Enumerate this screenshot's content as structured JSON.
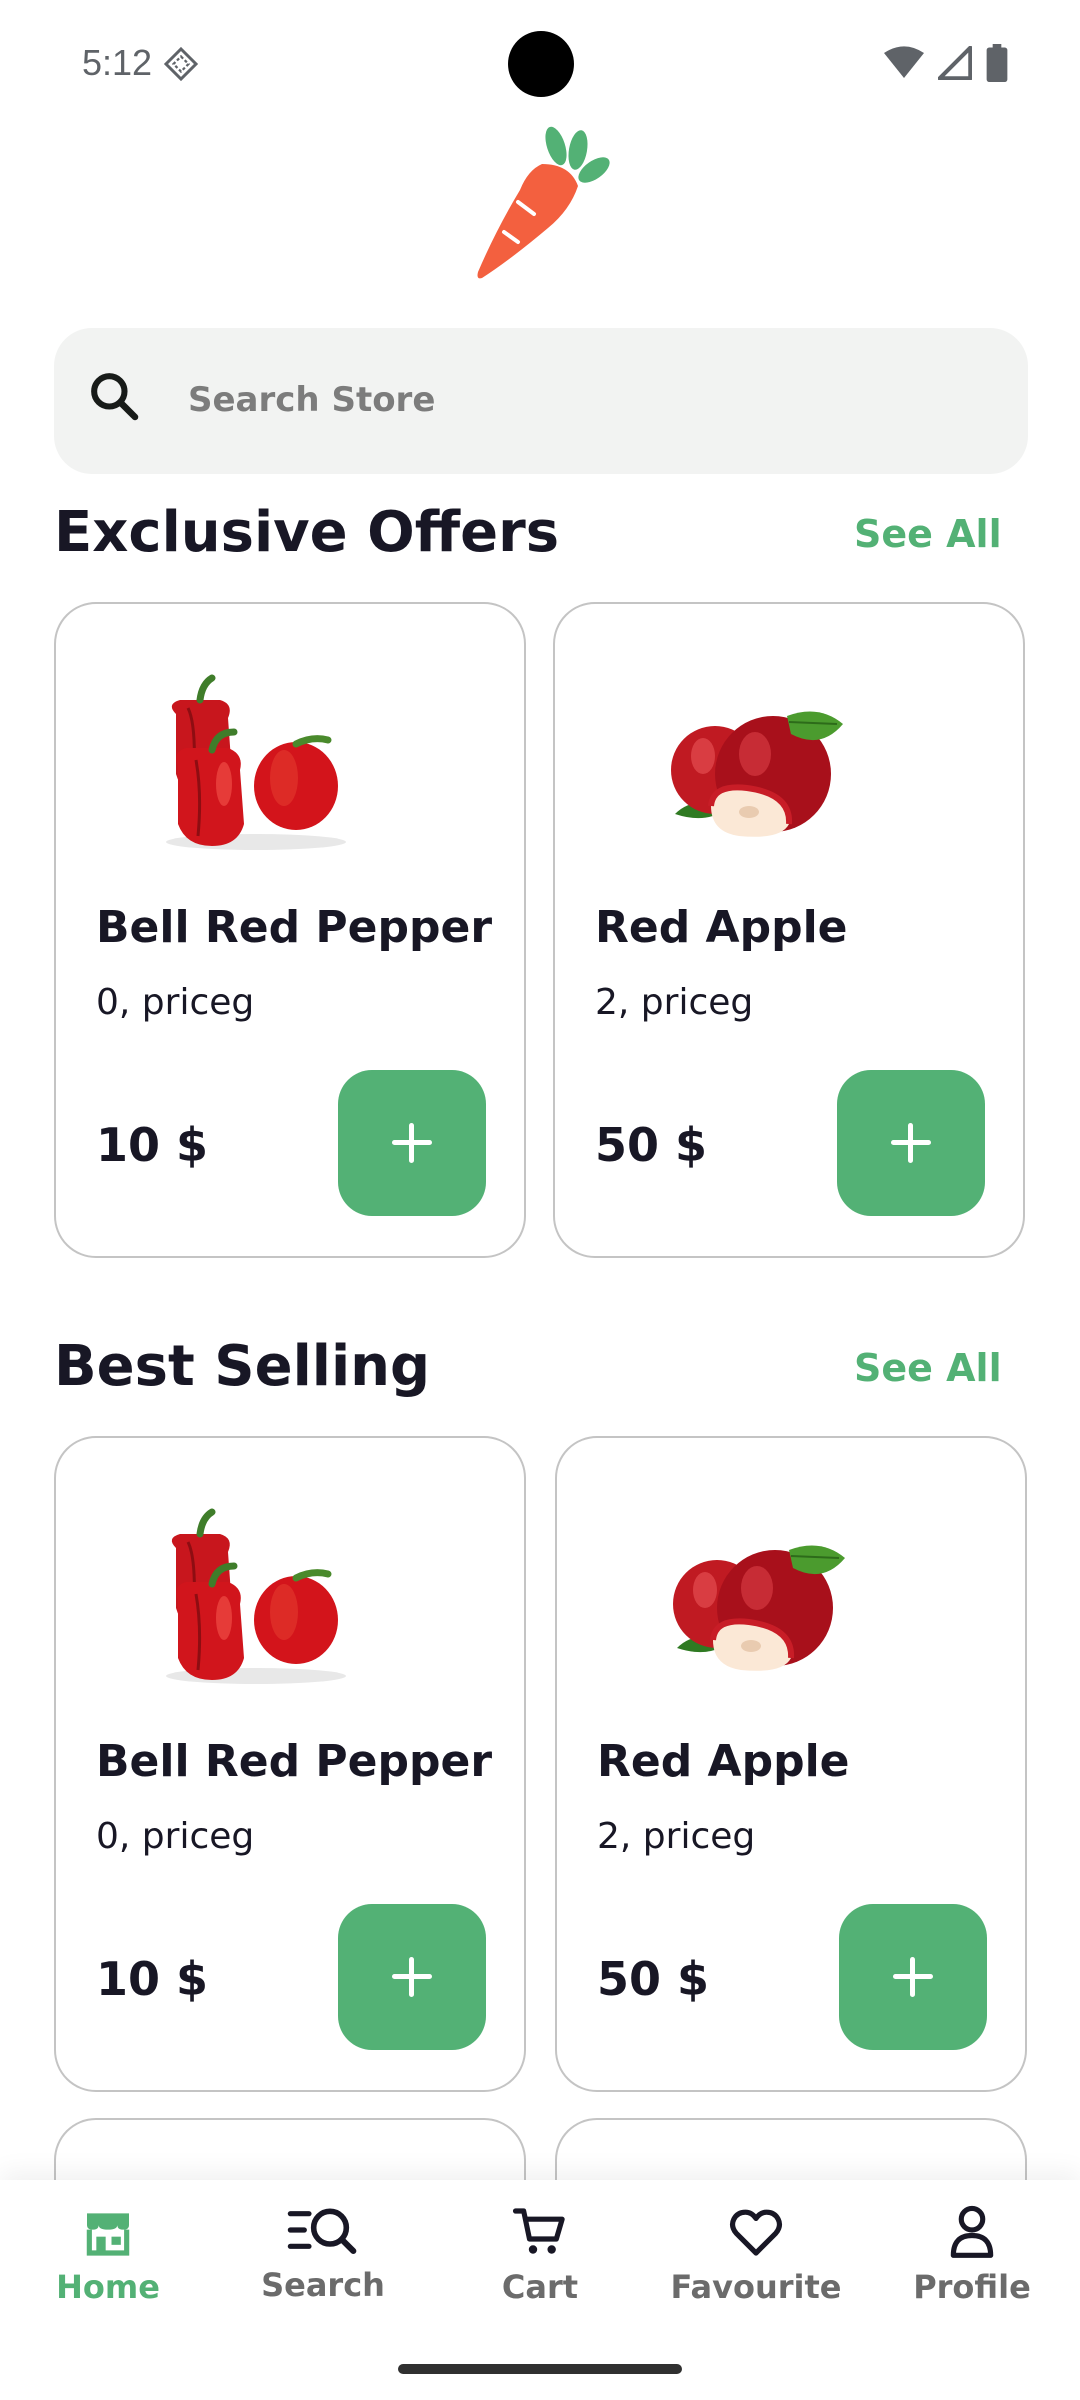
{
  "status_bar": {
    "time": "5:12"
  },
  "search": {
    "placeholder": "Search Store"
  },
  "sections": [
    {
      "title": "Exclusive Offers",
      "see_all": "See All",
      "products": [
        {
          "name": "Bell Red Pepper",
          "subtitle": "0, priceg",
          "price": "10 $",
          "image": "bell-pepper"
        },
        {
          "name": "Red Apple",
          "subtitle": "2, priceg",
          "price": "50 $",
          "image": "red-apple"
        }
      ]
    },
    {
      "title": "Best Selling",
      "see_all": "See All",
      "products": [
        {
          "name": "Bell Red Pepper",
          "subtitle": "0, priceg",
          "price": "10 $",
          "image": "bell-pepper"
        },
        {
          "name": "Red Apple",
          "subtitle": "2, priceg",
          "price": "50 $",
          "image": "red-apple"
        }
      ]
    }
  ],
  "bottom_nav": {
    "active": "Home",
    "items": [
      {
        "label": "Home",
        "icon": "store-icon"
      },
      {
        "label": "Search",
        "icon": "search-list-icon"
      },
      {
        "label": "Cart",
        "icon": "cart-icon"
      },
      {
        "label": "Favourite",
        "icon": "heart-icon"
      },
      {
        "label": "Profile",
        "icon": "profile-icon"
      }
    ]
  },
  "colors": {
    "accent": "#53b175",
    "text": "#181725",
    "muted": "#7c7c7c",
    "search_bg": "#f2f3f2",
    "logo": "#f3603f"
  }
}
